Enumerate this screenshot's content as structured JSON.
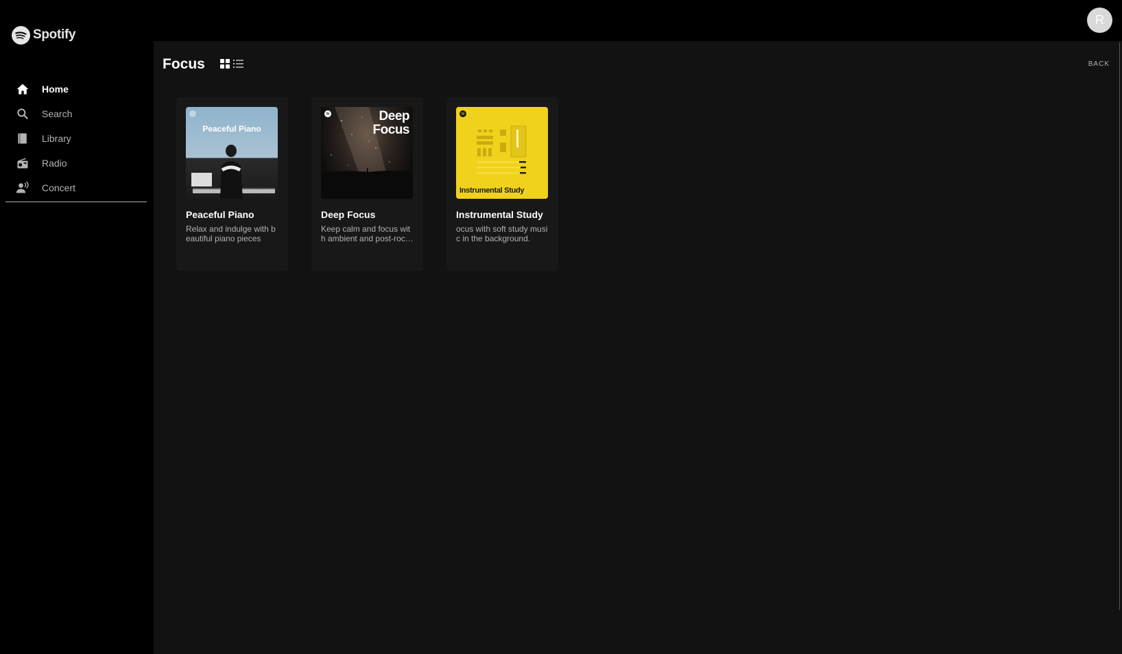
{
  "app": {
    "name": "Spotify"
  },
  "sidebar": {
    "items": [
      {
        "label": "Home",
        "icon": "home-icon",
        "active": true
      },
      {
        "label": "Search",
        "icon": "search-icon",
        "active": false
      },
      {
        "label": "Library",
        "icon": "library-icon",
        "active": false
      },
      {
        "label": "Radio",
        "icon": "radio-icon",
        "active": false
      },
      {
        "label": "Concert",
        "icon": "concert-icon",
        "active": false
      }
    ]
  },
  "topbar": {
    "avatar_initial": "R"
  },
  "main": {
    "title": "Focus",
    "back_label": "BACK",
    "view_modes": [
      "grid-view-icon",
      "list-view-icon"
    ],
    "cards": [
      {
        "title": "Peaceful Piano",
        "description": "Relax and indulge with beautiful piano pieces",
        "cover_text": "Peaceful Piano"
      },
      {
        "title": "Deep Focus",
        "description": "Keep calm and focus with ambient and post-rock music.",
        "cover_text_line1": "Deep",
        "cover_text_line2": "Focus"
      },
      {
        "title": "Instrumental Study",
        "description": "ocus with soft study music in the background.",
        "cover_text": "Instrumental Study"
      }
    ]
  },
  "colors": {
    "background": "#000000",
    "main_bg": "#121212",
    "card_bg": "#181818",
    "text_primary": "#ffffff",
    "text_secondary": "#b3b3b3",
    "study_yellow": "#f0d21c"
  }
}
